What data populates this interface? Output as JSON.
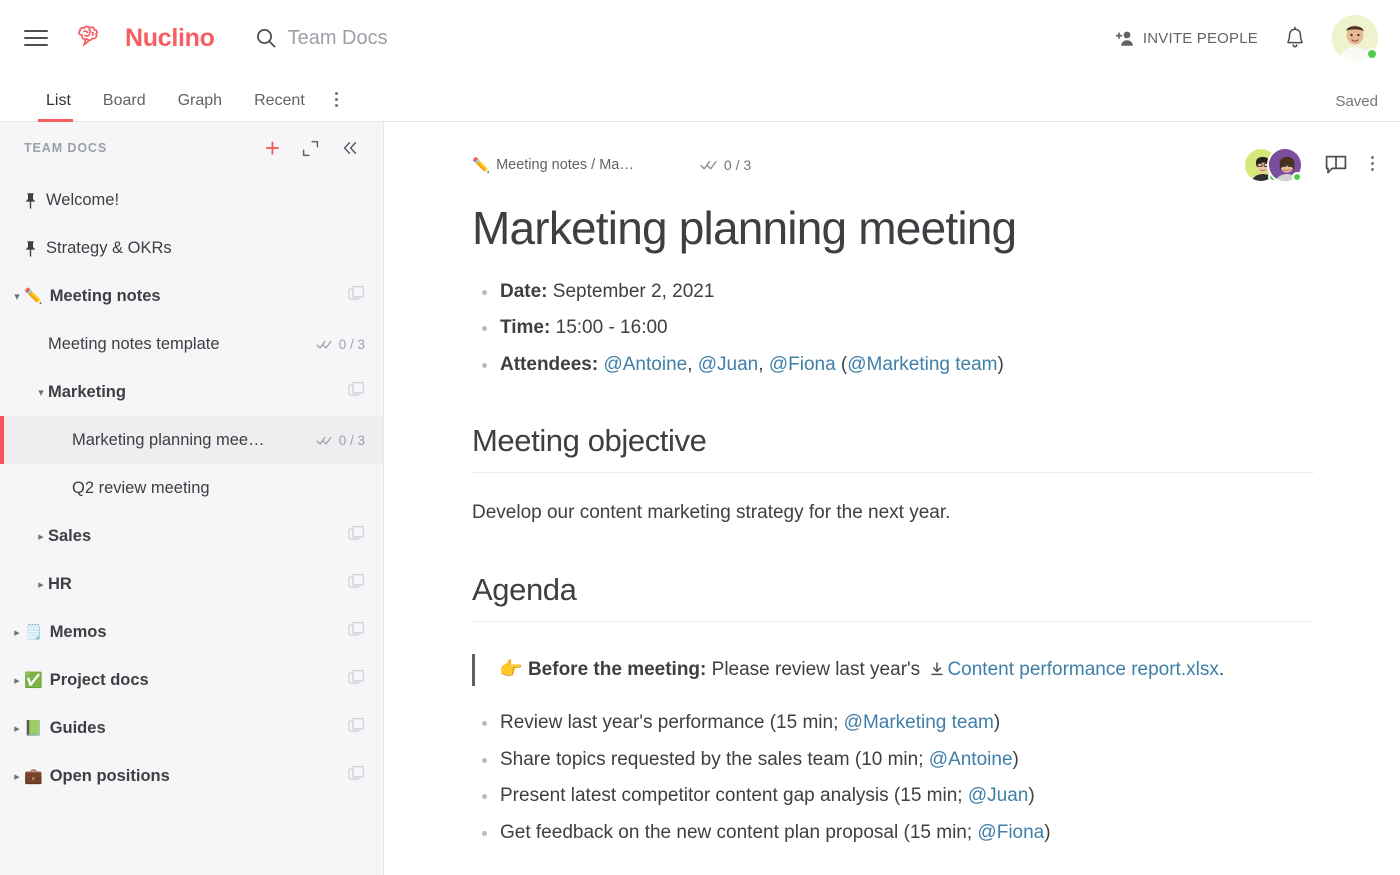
{
  "header": {
    "menu_icon": "hamburger-icon",
    "brand": "Nuclino",
    "search_placeholder": "Team Docs",
    "search_value": "",
    "search_icon": "search-icon",
    "invite_label": "INVITE PEOPLE",
    "invite_icon": "person-add-icon",
    "notifications_icon": "bell-icon",
    "avatar_icon": "user-avatar"
  },
  "tabs": {
    "items": [
      {
        "label": "List",
        "active": true
      },
      {
        "label": "Board",
        "active": false
      },
      {
        "label": "Graph",
        "active": false
      },
      {
        "label": "Recent",
        "active": false
      }
    ],
    "more_icon": "more-vertical-icon",
    "save_status": "Saved"
  },
  "sidebar": {
    "title": "TEAM DOCS",
    "add_icon": "plus-icon",
    "expand_icon": "expand-icon",
    "collapse_icon": "collapse-left-icon",
    "items": [
      {
        "label": "Welcome!",
        "level": 0,
        "icon": "pin-icon",
        "bold": false,
        "selected": false,
        "chevron": "",
        "tasks": "",
        "stack": false
      },
      {
        "label": "Strategy & OKRs",
        "level": 0,
        "icon": "pin-icon",
        "bold": false,
        "selected": false,
        "chevron": "",
        "tasks": "",
        "stack": false
      },
      {
        "label": "Meeting notes",
        "level": 0,
        "emoji": "✏️",
        "bold": true,
        "selected": false,
        "chevron": "down",
        "tasks": "",
        "stack": true
      },
      {
        "label": "Meeting notes template",
        "level": 1,
        "bold": false,
        "selected": false,
        "chevron": "",
        "tasks": "0 / 3",
        "stack": false
      },
      {
        "label": "Marketing",
        "level": 1,
        "bold": true,
        "selected": false,
        "chevron": "down",
        "tasks": "",
        "stack": true
      },
      {
        "label": "Marketing planning mee…",
        "level": 2,
        "bold": false,
        "selected": true,
        "chevron": "",
        "tasks": "0 / 3",
        "stack": false
      },
      {
        "label": "Q2 review meeting",
        "level": 2,
        "bold": false,
        "selected": false,
        "chevron": "",
        "tasks": "",
        "stack": false
      },
      {
        "label": "Sales",
        "level": 1,
        "bold": true,
        "selected": false,
        "chevron": "right",
        "tasks": "",
        "stack": true
      },
      {
        "label": "HR",
        "level": 1,
        "bold": true,
        "selected": false,
        "chevron": "right",
        "tasks": "",
        "stack": true
      },
      {
        "label": "Memos",
        "level": 0,
        "emoji": "🗒️",
        "bold": true,
        "selected": false,
        "chevron": "right",
        "tasks": "",
        "stack": true
      },
      {
        "label": "Project docs",
        "level": 0,
        "emoji": "✅",
        "bold": true,
        "selected": false,
        "chevron": "right",
        "tasks": "",
        "stack": true
      },
      {
        "label": "Guides",
        "level": 0,
        "emoji": "📗",
        "bold": true,
        "selected": false,
        "chevron": "right",
        "tasks": "",
        "stack": true
      },
      {
        "label": "Open positions",
        "level": 0,
        "emoji": "💼",
        "bold": true,
        "selected": false,
        "chevron": "right",
        "tasks": "",
        "stack": true
      }
    ]
  },
  "document": {
    "breadcrumb_emoji": "✏️",
    "breadcrumb": "Meeting notes / Ma…",
    "task_progress": "0 / 3",
    "task_icon": "double-check-icon",
    "comment_icon": "comment-icon",
    "more_icon": "more-vertical-icon",
    "title": "Marketing planning meeting",
    "meta_list": [
      {
        "label": "Date:",
        "value": " September 2, 2021"
      },
      {
        "label": "Time:",
        "value": " 15:00 - 16:00"
      }
    ],
    "attendees": {
      "label": "Attendees:",
      "mentions": [
        "@Antoine",
        "@Juan",
        "@Fiona"
      ],
      "group": "@Marketing team"
    },
    "objective": {
      "heading": "Meeting objective",
      "text": "Develop our content marketing strategy for the next year."
    },
    "agenda": {
      "heading": "Agenda",
      "callout": {
        "emoji": "👉",
        "label": "Before the meeting:",
        "text": " Please review last year's ",
        "link_icon": "download-icon",
        "link": "Content performance report.xlsx",
        "suffix": "."
      },
      "items": [
        {
          "text": "Review last year's performance (15 min; ",
          "mention": "@Marketing team",
          "suffix": ")"
        },
        {
          "text": "Share topics requested by the sales team (10 min; ",
          "mention": "@Antoine",
          "suffix": ")"
        },
        {
          "text": "Present latest competitor content gap analysis (15 min; ",
          "mention": "@Juan",
          "suffix": ")"
        },
        {
          "text": "Get feedback on the new content plan proposal (15 min; ",
          "mention": "@Fiona",
          "suffix": ")"
        }
      ]
    }
  },
  "colors": {
    "brand": "#f75e62",
    "accent_selected": "#f9515d",
    "link": "#3e7fa8",
    "sidebar_bg": "#f6f6f8",
    "online": "#4ccd4c"
  }
}
